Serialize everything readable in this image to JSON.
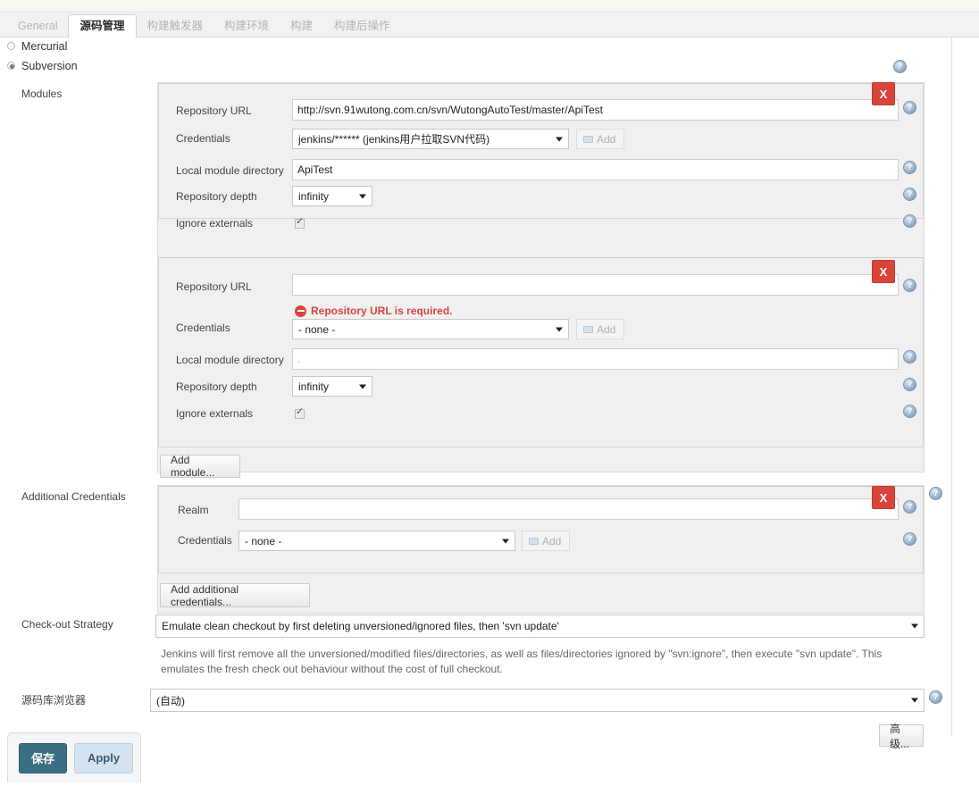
{
  "tabs": [
    {
      "label": "General",
      "active": false
    },
    {
      "label": "源码管理",
      "active": true
    },
    {
      "label": "构建触发器",
      "active": false
    },
    {
      "label": "构建环境",
      "active": false
    },
    {
      "label": "构建",
      "active": false
    },
    {
      "label": "构建后操作",
      "active": false
    }
  ],
  "scm_options": [
    {
      "label": "Mercurial",
      "selected": false
    },
    {
      "label": "Subversion",
      "selected": true
    }
  ],
  "sections": {
    "modules_label": "Modules",
    "additional_credentials_label": "Additional Credentials",
    "checkout_strategy_label": "Check-out Strategy",
    "repository_browser_label": "源码库浏览器"
  },
  "labels": {
    "repository_url": "Repository URL",
    "credentials": "Credentials",
    "local_module_directory": "Local module directory",
    "repository_depth": "Repository depth",
    "ignore_externals": "Ignore externals",
    "realm": "Realm"
  },
  "modules": [
    {
      "repository_url": "http://svn.91wutong.com.cn/svn/WutongAutoTest/master/ApiTest",
      "repository_url_placeholder": "",
      "credentials": "jenkins/****** (jenkins用户拉取SVN代码)",
      "local_module_directory": "ApiTest",
      "local_module_directory_placeholder": ".",
      "repository_depth": "infinity",
      "ignore_externals_checked": true,
      "error": null,
      "add_button": "Add",
      "delete_button": "X"
    },
    {
      "repository_url": "",
      "repository_url_placeholder": "",
      "credentials": "- none -",
      "local_module_directory": "",
      "local_module_directory_placeholder": ".",
      "repository_depth": "infinity",
      "ignore_externals_checked": true,
      "error": "Repository URL is required.",
      "add_button": "Add",
      "delete_button": "X"
    }
  ],
  "add_module_button": "Add module...",
  "additional_credentials": {
    "realm": "",
    "credentials": "- none -",
    "add_button": "Add",
    "delete_button": "X"
  },
  "add_additional_credentials_button": "Add additional credentials...",
  "checkout_strategy": {
    "value": "Emulate clean checkout by first deleting unversioned/ignored files, then 'svn update'",
    "description": "Jenkins will first remove all the unversioned/modified files/directories, as well as files/directories ignored by \"svn:ignore\", then execute \"svn update\". This emulates the fresh check out behaviour without the cost of full checkout."
  },
  "repository_browser": {
    "value": "(自动)"
  },
  "advanced_button": "高级...",
  "footer": {
    "save_button": "保存",
    "apply_button": "Apply",
    "ghost_label": "构建触发器"
  },
  "icons": {
    "help": "?"
  },
  "colors": {
    "accent": "#3a6f83",
    "error": "#d9453c",
    "panel": "#f0f0f0"
  }
}
